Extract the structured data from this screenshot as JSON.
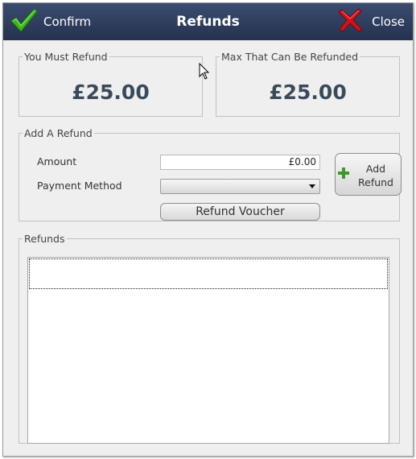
{
  "titlebar": {
    "confirm_label": "Confirm",
    "title": "Refunds",
    "close_label": "Close"
  },
  "must_refund": {
    "legend": "You Must Refund",
    "amount": "£25.00"
  },
  "max_refund": {
    "legend": "Max That Can Be Refunded",
    "amount": "£25.00"
  },
  "add_refund": {
    "legend": "Add A Refund",
    "amount_label": "Amount",
    "amount_value": "£0.00",
    "payment_method_label": "Payment Method",
    "payment_method_value": "",
    "voucher_button": "Refund Voucher",
    "add_button_line1": "Add",
    "add_button_line2": "Refund"
  },
  "refunds": {
    "legend": "Refunds",
    "rows": []
  },
  "colors": {
    "titlebar": "#2c3a5a",
    "confirm_check": "#39b81c",
    "close_x": "#d1121b",
    "plus": "#3e9a2c",
    "amount_text": "#3a4a5a"
  },
  "icons": {
    "confirm": "checkmark-icon",
    "close": "close-icon",
    "add": "plus-icon",
    "dropdown": "chevron-down-icon",
    "cursor": "mouse-pointer-icon"
  }
}
